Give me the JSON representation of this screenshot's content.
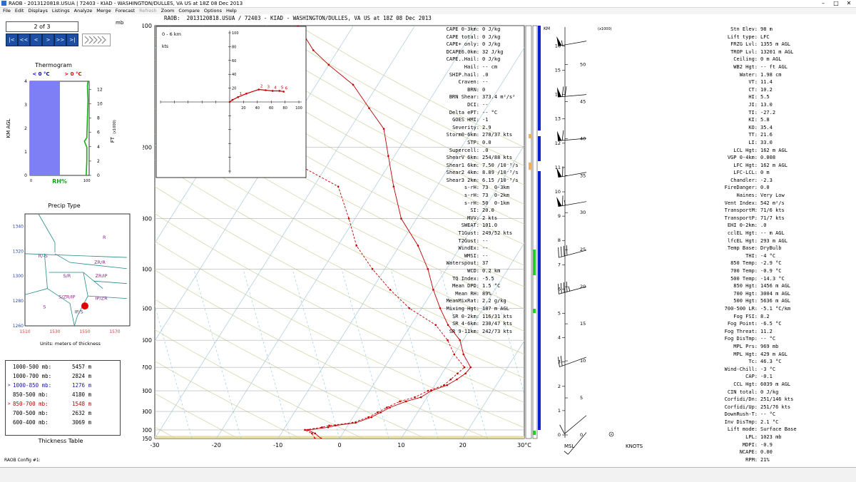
{
  "window": {
    "title": "RAOB - 2013120818.USUA | 72403 - KIAD - WASHINGTON/DULLES, VA US at 18Z 08 Dec 2013",
    "minimize": "–",
    "maximize": "□",
    "close": "✕"
  },
  "menu": [
    {
      "label": "File",
      "enabled": true
    },
    {
      "label": "Edit",
      "enabled": true
    },
    {
      "label": "Displays",
      "enabled": true
    },
    {
      "label": "Listings",
      "enabled": true
    },
    {
      "label": "Analyze",
      "enabled": true
    },
    {
      "label": "Merge",
      "enabled": true
    },
    {
      "label": "Forecast",
      "enabled": true
    },
    {
      "label": "Refresh",
      "enabled": false
    },
    {
      "label": "Zoom",
      "enabled": true
    },
    {
      "label": "Compare",
      "enabled": true
    },
    {
      "label": "Options",
      "enabled": true
    },
    {
      "label": "Help",
      "enabled": true
    }
  ],
  "header": "RAOB:  2013120818.USUA / 72403 - KIAD - WASHINGTON/DULLES, VA US at 18Z 08 Dec 2013",
  "nav": {
    "page": "2 of 3",
    "unit": "mb",
    "buttons": [
      "|<",
      "<<",
      "<",
      ">",
      ">>",
      ">|"
    ],
    "colors": {
      "button": "#1c4fa3"
    }
  },
  "thermogram": {
    "title": "Thermogram",
    "below_zero": "< 0 °C",
    "above_zero": "> 0 °C",
    "xlabel": "RH%",
    "ylabel_left": "KM AGL",
    "ylabel_right": "FT",
    "ylabel_right_unit": "(x1000)",
    "x_min": "0",
    "x_max": "100",
    "km_ticks": [
      "0",
      "1",
      "2",
      "3",
      "4"
    ],
    "ft_ticks": [
      "0",
      "2",
      "4",
      "6",
      "8",
      "10",
      "12"
    ],
    "rh_profile": [
      [
        95,
        0
      ],
      [
        96,
        0.6
      ],
      [
        96,
        1.2
      ],
      [
        92,
        1.45
      ],
      [
        96,
        1.6
      ],
      [
        97,
        2.4
      ],
      [
        98,
        3.2
      ],
      [
        97,
        3.8
      ],
      [
        98,
        4
      ]
    ],
    "colors": {
      "cold": "#7f7ff5",
      "line": "#16b016",
      "below": "#0000cc",
      "above": "#e00000"
    }
  },
  "precip": {
    "title": "Precip Type",
    "units": "Units: meters of thickness",
    "y_ticks": [
      "1340",
      "1320",
      "1300",
      "1280",
      "1260"
    ],
    "x_ticks": [
      "1510",
      "1530",
      "1550",
      "1570"
    ],
    "regions": [
      "R",
      "R/-S",
      "ZR/R",
      "S/R",
      "ZR/IP",
      "S/ZR/IP",
      "IP/ZR",
      "S",
      "IP/S"
    ],
    "point": {
      "x": 1550,
      "y": 1276
    }
  },
  "thickness_table": {
    "title": "Thickness Table",
    "rows": [
      {
        "layer": "1000-500 mb:",
        "value": "5457 m",
        "marker": "",
        "color": "#000000"
      },
      {
        "layer": "1000-700 mb:",
        "value": "2824 m",
        "marker": "",
        "color": "#000000"
      },
      {
        "layer": "1000-850 mb:",
        "value": "1276 m",
        "marker": ">",
        "color": "#1a1aa6"
      },
      {
        "layer": "850-500 mb:",
        "value": "4180 m",
        "marker": "",
        "color": "#000000"
      },
      {
        "layer": "850-700 mb:",
        "value": "1548 m",
        "marker": ">",
        "color": "#c00000"
      },
      {
        "layer": "700-500 mb:",
        "value": "2632 m",
        "marker": "",
        "color": "#000000"
      },
      {
        "layer": "600-400 mb:",
        "value": "3069 m",
        "marker": "",
        "color": "#000000"
      }
    ]
  },
  "status": "RAOB Config #1:",
  "skewt": {
    "pressure_ticks": [
      "100",
      "200",
      "300",
      "400",
      "500",
      "600",
      "700",
      "800",
      "900",
      "1000",
      "1050"
    ],
    "temp_ticks": [
      "-30",
      "-20",
      "-10",
      "0",
      "10",
      "20",
      "30°C"
    ],
    "temperature": [
      [
        1050,
        -3
      ],
      [
        1020,
        -4.5
      ],
      [
        1000,
        -6
      ],
      [
        985,
        -3
      ],
      [
        975,
        -2
      ],
      [
        960,
        1
      ],
      [
        930,
        3
      ],
      [
        905,
        4
      ],
      [
        880,
        5
      ],
      [
        850,
        7
      ],
      [
        830,
        9
      ],
      [
        800,
        10
      ],
      [
        775,
        12
      ],
      [
        750,
        13
      ],
      [
        725,
        13.8
      ],
      [
        700,
        14
      ],
      [
        650,
        11.5
      ],
      [
        600,
        9.5
      ],
      [
        550,
        6
      ],
      [
        500,
        3
      ],
      [
        450,
        0
      ],
      [
        400,
        -3
      ],
      [
        350,
        -7
      ],
      [
        300,
        -12.5
      ],
      [
        250,
        -17
      ],
      [
        210,
        -21
      ],
      [
        180,
        -24.5
      ],
      [
        160,
        -29
      ],
      [
        140,
        -34
      ],
      [
        125,
        -40
      ],
      [
        115,
        -44
      ],
      [
        100,
        -49
      ]
    ],
    "dewpoint": [
      [
        1050,
        -4
      ],
      [
        1020,
        -5
      ],
      [
        1000,
        -6.5
      ],
      [
        985,
        -4
      ],
      [
        975,
        -3
      ],
      [
        960,
        0.5
      ],
      [
        930,
        2.5
      ],
      [
        905,
        3.5
      ],
      [
        880,
        4.5
      ],
      [
        850,
        6
      ],
      [
        830,
        8
      ],
      [
        800,
        9.5
      ],
      [
        775,
        11.5
      ],
      [
        750,
        12
      ],
      [
        725,
        12.5
      ],
      [
        700,
        13
      ],
      [
        650,
        10
      ],
      [
        600,
        7.5
      ],
      [
        550,
        4
      ],
      [
        500,
        -2
      ],
      [
        450,
        -7
      ],
      [
        400,
        -12
      ],
      [
        350,
        -17
      ],
      [
        300,
        -21
      ],
      [
        250,
        -26
      ],
      [
        220,
        -35
      ],
      [
        205,
        -45
      ],
      [
        195,
        -55
      ]
    ]
  },
  "hodograph": {
    "title": "0 - 6 km",
    "unit": "kts",
    "axis_ticks": [
      "20",
      "40",
      "60",
      "80",
      "100"
    ],
    "points": [
      [
        0,
        0
      ],
      [
        4,
        3
      ],
      [
        12,
        7
      ],
      [
        24,
        12
      ],
      [
        42,
        18
      ],
      [
        52,
        17
      ],
      [
        62,
        16
      ],
      [
        72,
        16
      ],
      [
        78,
        15
      ]
    ],
    "labels": [
      "",
      "1",
      "2",
      "3",
      "4",
      "5",
      "6"
    ]
  },
  "indices": [
    [
      "CAPE 0-3km:",
      "0 J/kg"
    ],
    [
      "CAPE total:",
      "0 J/kg"
    ],
    [
      "CAPE+ only:",
      "0 J/kg"
    ],
    [
      "DCAPE6.0km:",
      "32 J/kg"
    ],
    [
      "CAPE..Hail:",
      "0 J/kg"
    ],
    [
      "Hail:",
      "-- cm"
    ],
    [
      "SHIP.hail:",
      ".0"
    ],
    [
      "Craven:",
      "--"
    ],
    [
      "BRN:",
      "0"
    ],
    [
      "BRN Shear:",
      "373.4 m²/s²"
    ],
    [
      "DCI:",
      "--"
    ],
    [
      "Delta ePT:",
      "-- °C"
    ],
    [
      "GOES HMI:",
      "-1"
    ],
    [
      "Severity:",
      "2.9"
    ],
    [
      "Storm0-6km:",
      "278/37 kts"
    ],
    [
      "STP:",
      "0.0"
    ],
    [
      "Supercell:",
      ".0"
    ],
    [
      "ShearV 6km:",
      "254/88 kts"
    ],
    [
      "Shear1 6km:",
      "7.50 /10⁻³/s"
    ],
    [
      "Shear2 4km:",
      "8.89 /10⁻³/s"
    ],
    [
      "Shear3 2km:",
      "6.15 /10⁻³/s"
    ],
    [
      "s-rH:",
      "73  0-3km"
    ],
    [
      "s-rH:",
      "73  0-2km"
    ],
    [
      "s-rH:",
      "50  0-1km"
    ],
    [
      "SI:",
      "20.0"
    ],
    [
      "MVV:",
      "2 kts"
    ],
    [
      "SWEAT:",
      "101.0"
    ],
    [
      "T1Gust:",
      "249/52 kts"
    ],
    [
      "T2Gust:",
      "--"
    ],
    [
      "WindEx:",
      "--"
    ],
    [
      "WMSI:",
      "--"
    ],
    [
      "Waterspout:",
      "37"
    ],
    [
      "WCD:",
      "0.2 km"
    ],
    [
      "TQ Index:",
      "-5.5"
    ],
    [
      "Mean DPD:",
      "1.5 °C"
    ],
    [
      "Mean RH:",
      "89%"
    ],
    [
      "MeanMixRat:",
      "2.2 g/kg"
    ],
    [
      "Mixing Hgt:",
      "187 m AGL"
    ],
    [
      "SR 0-2km:",
      "116/31 kts"
    ],
    [
      "SR 4-6km:",
      "230/47 kts"
    ],
    [
      "SR 9-11km:",
      "242/73 kts"
    ]
  ],
  "wind_panel": {
    "km_label": "KM",
    "msl_label": "MSL",
    "knots_label": "KNOTS",
    "ft_unit": "(x1000)",
    "km_ticks": [
      "0",
      "1",
      "2",
      "3",
      "4",
      "5",
      "6",
      "7",
      "8",
      "9",
      "10",
      "11",
      "12",
      "13",
      "14",
      "15",
      "16"
    ],
    "ft_ticks": [
      "0",
      "5",
      "10",
      "15",
      "20",
      "25",
      "30",
      "35",
      "40",
      "45",
      "50"
    ],
    "barbs": [
      {
        "km": 0.1,
        "speed": 5,
        "dir": 220
      },
      {
        "km": 0.8,
        "speed": 10,
        "dir": 230
      },
      {
        "km": 3.2,
        "speed": 20,
        "dir": 250
      },
      {
        "km": 6.1,
        "speed": 45,
        "dir": 255
      },
      {
        "km": 7.6,
        "speed": 40,
        "dir": 255
      },
      {
        "km": 9.6,
        "speed": 65,
        "dir": 260
      },
      {
        "km": 10.8,
        "speed": 60,
        "dir": 260
      },
      {
        "km": 12.2,
        "speed": 60,
        "dir": 265
      },
      {
        "km": 14.0,
        "speed": 70,
        "dir": 265
      },
      {
        "km": 16.2,
        "speed": 55,
        "dir": 260
      }
    ],
    "colors": {
      "bar": "#0a20d0",
      "green": "#22d022",
      "orange": "#f0b060"
    }
  },
  "stn": [
    [
      "Stn Elev:",
      "98 m"
    ],
    [
      "Lift type:",
      "LFC"
    ],
    [
      "FRZG Lvl:",
      "1355 m AGL"
    ],
    [
      "TROP Lvl:",
      "13201 m AGL"
    ],
    [
      "Ceiling:",
      "0 m AGL"
    ],
    [
      "WB2 Hgt:",
      "-- ft AGL"
    ],
    [
      "Water:",
      "1.98 cm"
    ],
    [
      "VT:",
      "11.4"
    ],
    [
      "CT:",
      "10.2"
    ],
    [
      "HI:",
      "5.5"
    ],
    [
      "JI:",
      "13.0"
    ],
    [
      "TI:",
      "-27.2"
    ],
    [
      "KI:",
      "5.8"
    ],
    [
      "KO:",
      "35.4"
    ],
    [
      "TT:",
      "21.6"
    ],
    [
      "LI:",
      "33.0"
    ],
    [
      "LCL Hgt:",
      "162 m AGL"
    ],
    [
      "VGP 0-4km:",
      "0.008"
    ],
    [
      "LFC Hgt:",
      "162 m AGL"
    ],
    [
      "LFC-LCL:",
      "0 m"
    ],
    [
      "Chandler:",
      "-2.3"
    ],
    [
      "FireDanger:",
      "0.0"
    ],
    [
      "Haines:",
      "Very Low"
    ],
    [
      "Vent Index:",
      "542 m²/s"
    ],
    [
      "TransportM:",
      "71/6 kts"
    ],
    [
      "TransportP:",
      "71/7 kts"
    ],
    [
      "EHI 0-2km:",
      ".0"
    ],
    [
      "cclEL Hgt:",
      "-- m AGL"
    ],
    [
      "lfcEL Hgt:",
      "293 m AGL"
    ],
    [
      "Temp Base:",
      "DryBulb"
    ],
    [
      "THI:",
      "-4 °C"
    ],
    [
      "850 Temp:",
      "-2.9 °C"
    ],
    [
      "700 Temp:",
      "-0.9 °C"
    ],
    [
      "500 Temp:",
      "-14.3 °C"
    ],
    [
      "850 Hgt:",
      "1456 m AGL"
    ],
    [
      "700 Hgt:",
      "3004 m AGL"
    ],
    [
      "500 Hgt:",
      "5636 m AGL"
    ],
    [
      "700-500 LR:",
      "-5.1 °C/km"
    ],
    [
      "Fog FSI:",
      "8.2"
    ],
    [
      "Fog Point:",
      "-6.5 °C"
    ],
    [
      "Fog Threat:",
      "11.2"
    ],
    [
      "Fog DisTmp:",
      "-- °C"
    ],
    [
      "MPL Prs:",
      "969 mb"
    ],
    [
      "MPL Hgt:",
      "429 m AGL"
    ],
    [
      "Tc:",
      "46.3 °C"
    ],
    [
      "Wind-Chill:",
      "-3 °C"
    ],
    [
      "CAP:",
      "-0.1"
    ],
    [
      "CCL Hgt:",
      "6039 m AGL"
    ],
    [
      "CIN total:",
      "0 J/kg"
    ],
    [
      "Corfidi/Dn:",
      "251/146 kts"
    ],
    [
      "Corfidi/Up:",
      "251/76 kts"
    ],
    [
      "DownRush-T:",
      "-- °C"
    ],
    [
      "Inv DisTmp:",
      "2.1 °C"
    ],
    [
      "Lift mode:",
      "Surface Base"
    ],
    [
      "LPL:",
      "1023 mb"
    ],
    [
      "MDPI:",
      "-0.9"
    ],
    [
      "NCAPE:",
      "0.00"
    ],
    [
      "RPM:",
      "21%"
    ]
  ]
}
